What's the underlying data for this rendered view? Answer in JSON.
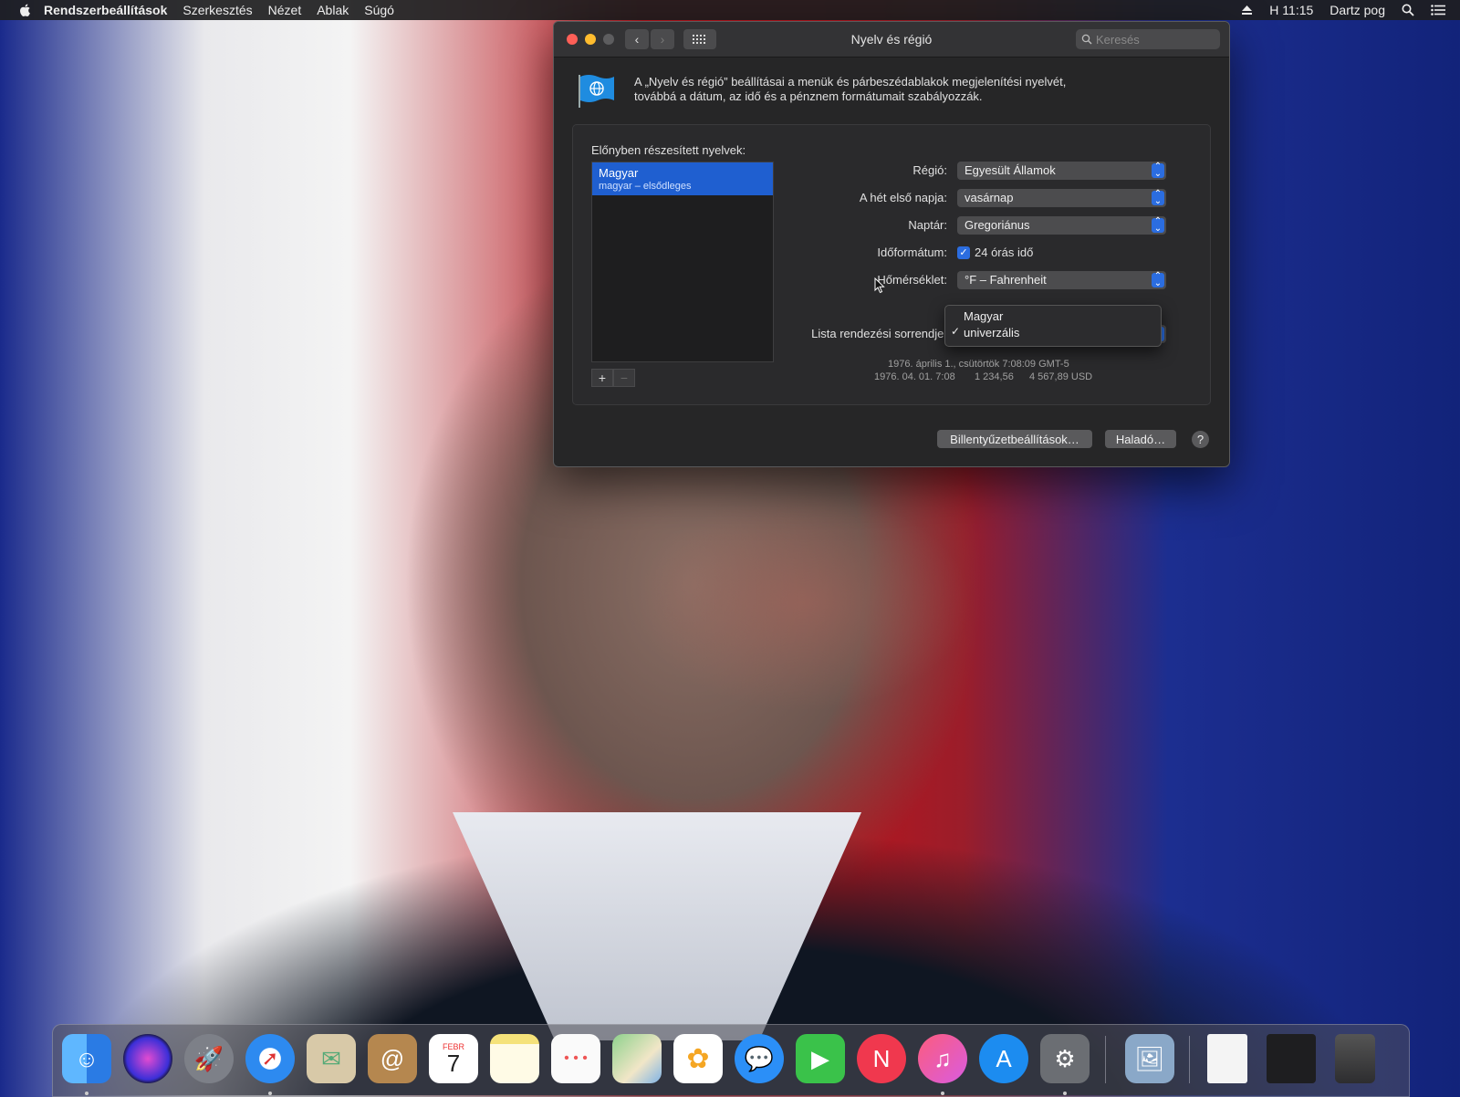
{
  "menubar": {
    "app": "Rendszerbeállítások",
    "items": [
      "Szerkesztés",
      "Nézet",
      "Ablak",
      "Súgó"
    ],
    "clock": "H 11:15",
    "user": "Dartz pog"
  },
  "window": {
    "title": "Nyelv és régió",
    "search_placeholder": "Keresés",
    "description_line1": "A „Nyelv és régió” beállításai a menük és párbeszédablakok megjelenítési nyelvét,",
    "description_line2": "továbbá a dátum, az idő és a pénznem formátumait szabályozzák.",
    "languages_label": "Előnyben részesített nyelvek:",
    "language": {
      "name": "Magyar",
      "sub": "magyar – elsődleges"
    },
    "fields": {
      "region_label": "Régió:",
      "region_value": "Egyesült Államok",
      "firstday_label": "A hét első napja:",
      "firstday_value": "vasárnap",
      "calendar_label": "Naptár:",
      "calendar_value": "Gregoriánus",
      "timeformat_label": "Időformátum:",
      "timeformat_value": "24 órás idő",
      "temperature_label": "Hőmérséklet:",
      "temperature_value": "°F – Fahrenheit",
      "sortorder_label": "Lista rendezési sorrendje:"
    },
    "dropdown": {
      "items": [
        "Magyar",
        "univerzális"
      ],
      "selected": "univerzális"
    },
    "sample_line1": "1976. április 1., csütörtök 7:08:09 GMT-5",
    "sample_date": "1976. 04. 01. 7:08",
    "sample_number": "1 234,56",
    "sample_currency": "4 567,89 USD",
    "buttons": {
      "keyboard": "Billentyűzetbeállítások…",
      "advanced": "Haladó…",
      "help": "?"
    }
  },
  "dock": {
    "calendar_month": "FEBR",
    "calendar_day": "7",
    "apps": [
      "finder",
      "siri",
      "launchpad",
      "safari",
      "mail",
      "contacts",
      "calendar",
      "notes",
      "reminders",
      "maps",
      "photos",
      "messages",
      "facetime",
      "news",
      "itunes",
      "app-store",
      "system-preferences",
      "preview",
      "document",
      "downloads",
      "trash"
    ]
  },
  "colors": {
    "accent": "#2b6de0",
    "window_bg": "#262627"
  }
}
